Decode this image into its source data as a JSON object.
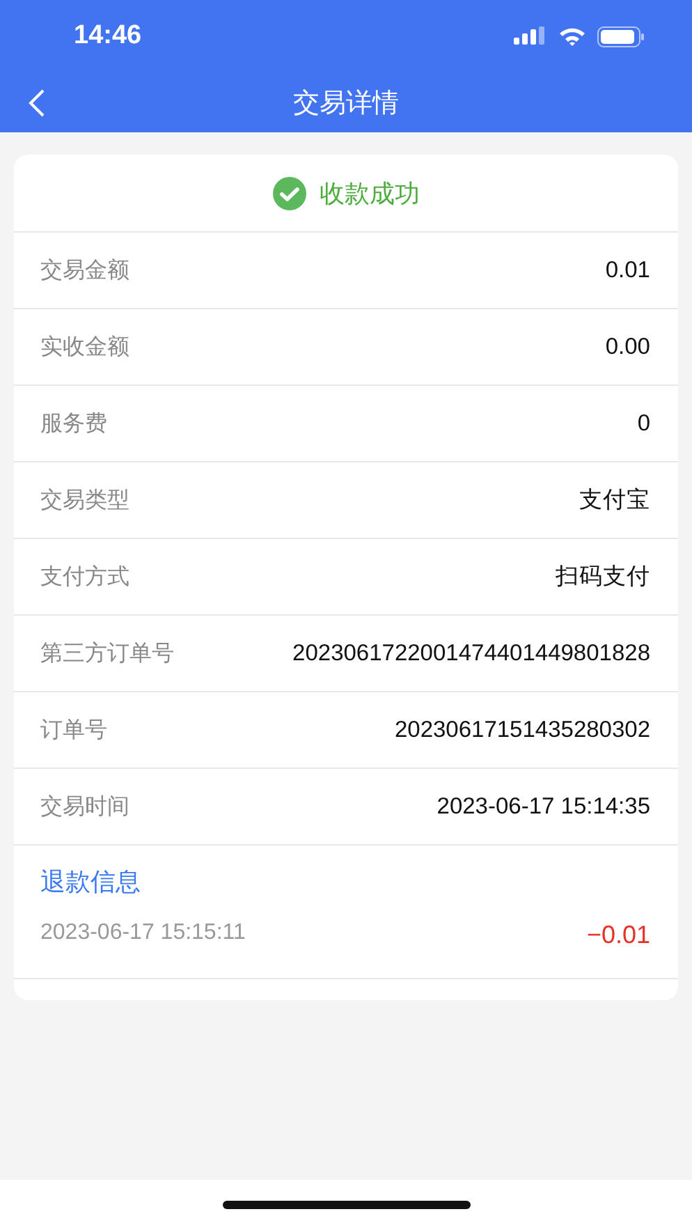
{
  "status_bar": {
    "time": "14:46"
  },
  "nav": {
    "title": "交易详情"
  },
  "result": {
    "text": "收款成功"
  },
  "rows": [
    {
      "label": "交易金额",
      "value": "0.01"
    },
    {
      "label": "实收金额",
      "value": "0.00"
    },
    {
      "label": "服务费",
      "value": "0"
    },
    {
      "label": "交易类型",
      "value": "支付宝"
    },
    {
      "label": "支付方式",
      "value": "扫码支付"
    },
    {
      "label": "第三方订单号",
      "value": "2023061722001474401449801828"
    },
    {
      "label": "订单号",
      "value": "20230617151435280302"
    },
    {
      "label": "交易时间",
      "value": "2023-06-17 15:14:35"
    }
  ],
  "refund": {
    "title": "退款信息",
    "items": [
      {
        "time": "2023-06-17 15:15:11",
        "amount": "−0.01"
      }
    ]
  }
}
